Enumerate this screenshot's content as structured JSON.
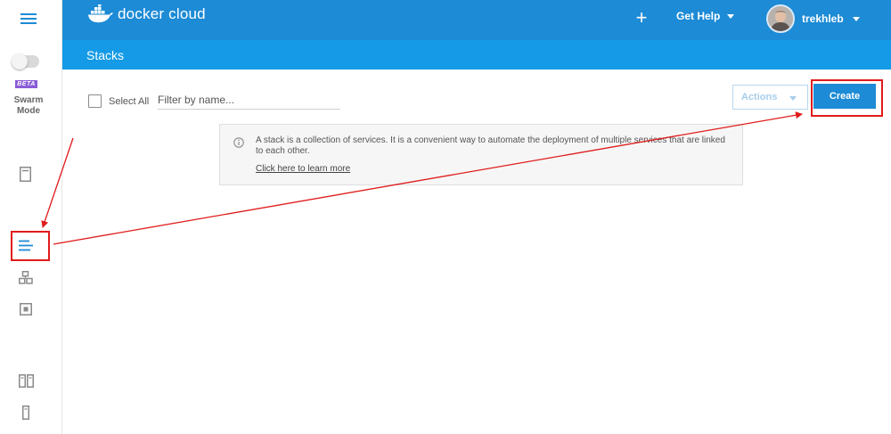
{
  "app": {
    "brand": "docker cloud",
    "brand_color": "#1d8bd6",
    "subheader_color": "#149ae6"
  },
  "sidebar": {
    "menu_icon": "hamburger-icon",
    "beta_badge": "BETA",
    "swarm_mode_label": "Swarm Mode",
    "swarm_mode_enabled": false,
    "items": [
      {
        "name": "repositories",
        "icon": "document-icon"
      },
      {
        "name": "stacks",
        "icon": "stacks-icon",
        "active": true
      },
      {
        "name": "services",
        "icon": "services-icon"
      },
      {
        "name": "containers",
        "icon": "container-icon"
      },
      {
        "name": "node-clusters",
        "icon": "node-cluster-icon"
      },
      {
        "name": "nodes",
        "icon": "node-icon"
      }
    ]
  },
  "header": {
    "add_label": "+",
    "help_label": "Get Help",
    "username": "trekhleb"
  },
  "page": {
    "title": "Stacks"
  },
  "toolbar": {
    "select_all_label": "Select All",
    "filter_placeholder": "Filter by name...",
    "actions_label": "Actions",
    "create_label": "Create"
  },
  "info": {
    "text": "A stack is a collection of services. It is a convenient way to automate the deployment of multiple services that are linked to each other.",
    "link_text": "Click here to learn more"
  },
  "annotations": {
    "highlight_color": "#e01b1b"
  }
}
